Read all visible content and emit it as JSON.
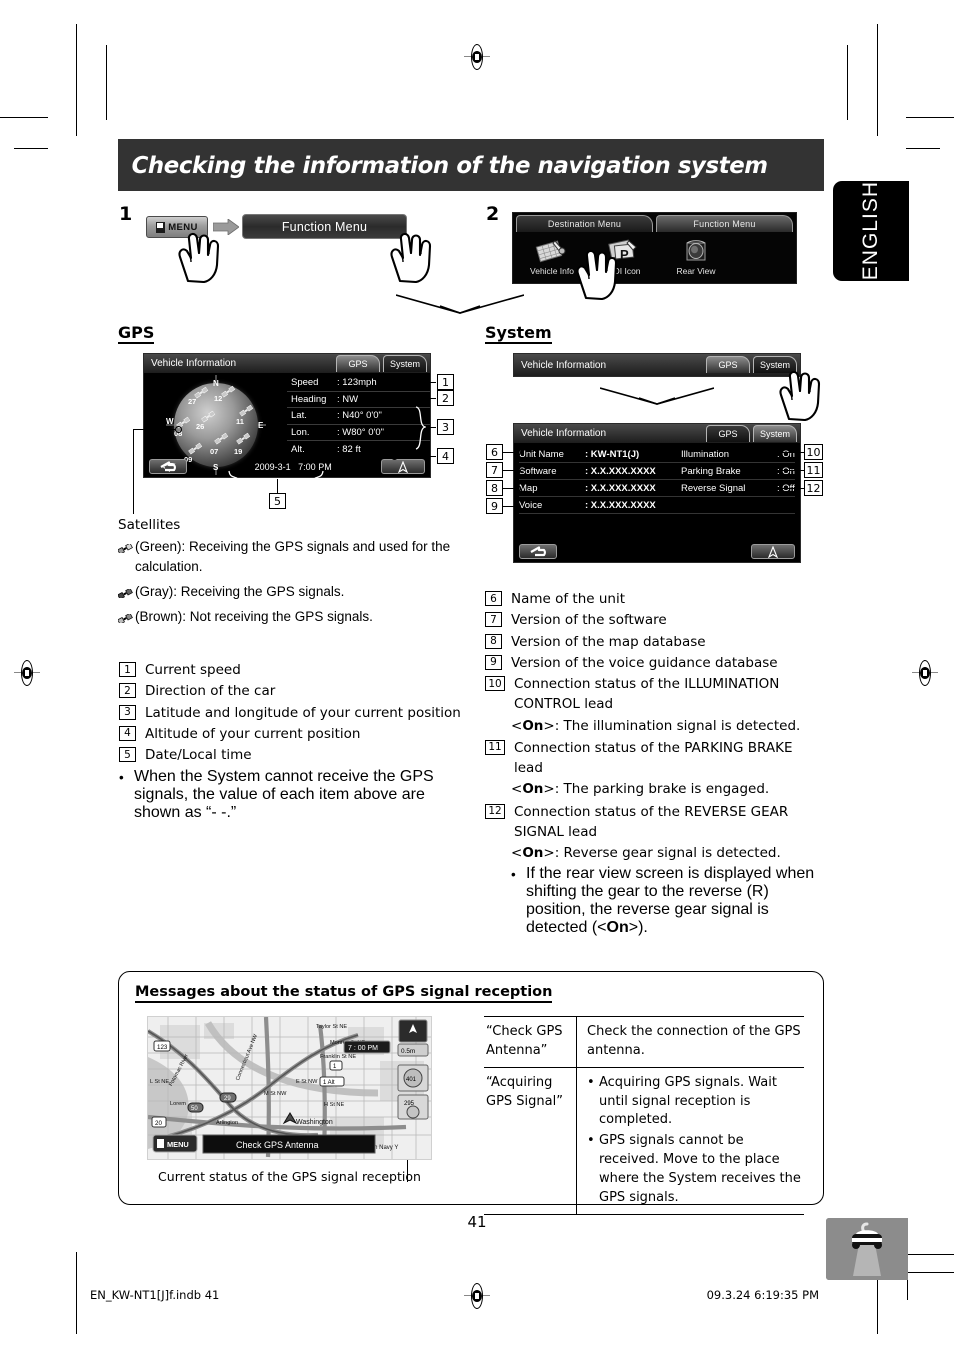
{
  "header": {
    "title": "Checking the information of the navigation system"
  },
  "language_tab": {
    "label": "ENGLISH"
  },
  "steps": {
    "one": {
      "number": "1",
      "menu_key_label": "MENU",
      "function_menu_button": "Function Menu"
    },
    "two": {
      "number": "2",
      "tabs": [
        {
          "label": "Destination Menu",
          "active": false
        },
        {
          "label": "Function Menu",
          "active": true
        }
      ],
      "icons": [
        {
          "label": "Vehicle Info",
          "icon": "vehicle-info-icon"
        },
        {
          "label": "POI Icon",
          "icon": "poi-icon"
        },
        {
          "label": "Rear View",
          "icon": "rear-view-icon"
        }
      ]
    }
  },
  "gps_section": {
    "heading": "GPS",
    "screen": {
      "title": "Vehicle Information",
      "tabs": [
        {
          "label": "GPS",
          "active": true
        },
        {
          "label": "System",
          "active": false
        }
      ],
      "compass": {
        "north": "N",
        "south": "S",
        "east": "E",
        "west": "W",
        "satellites": [
          "27",
          "12",
          "11",
          "26",
          "08",
          "07",
          "19",
          "09"
        ]
      },
      "rows": [
        {
          "key": "Speed",
          "value": ": 123mph"
        },
        {
          "key": "Heading",
          "value": ": NW"
        },
        {
          "key": "Lat.",
          "value": ": N40°  0'0\""
        },
        {
          "key": "Lon.",
          "value": ": W80°  0'0\""
        },
        {
          "key": "Alt.",
          "value": ": 82 ft"
        }
      ],
      "date": "2009-3-1",
      "time": "7:00 PM",
      "back_icon": "back-arrow-icon",
      "nav_icon": "navigation-arrow-icon"
    },
    "callouts": [
      "1",
      "2",
      "3",
      "4",
      "5"
    ],
    "satellites_label": "Satellites",
    "satellite_legend": [
      {
        "icon": "satellite-icon-green",
        "text": "(Green): Receiving the GPS signals and used for the calculation."
      },
      {
        "icon": "satellite-icon-gray",
        "text": "(Gray): Receiving the GPS signals."
      },
      {
        "icon": "satellite-icon-brown",
        "text": "(Brown): Not receiving the GPS signals."
      }
    ],
    "items": [
      {
        "n": "1",
        "text": "Current speed"
      },
      {
        "n": "2",
        "text": "Direction of the car"
      },
      {
        "n": "3",
        "text": "Latitude and longitude of your current position"
      },
      {
        "n": "4",
        "text": "Altitude of your current position"
      },
      {
        "n": "5",
        "text": "Date/Local time"
      }
    ],
    "note": "When the System cannot receive the GPS signals, the value of each item above are shown as “- -.”"
  },
  "system_section": {
    "heading": "System",
    "top_screen": {
      "title": "Vehicle Information",
      "tabs": [
        {
          "label": "GPS",
          "active": true
        },
        {
          "label": "System",
          "active": false
        }
      ]
    },
    "screen": {
      "title": "Vehicle Information",
      "tabs": [
        {
          "label": "GPS",
          "active": false
        },
        {
          "label": "System",
          "active": true
        }
      ],
      "rows": [
        {
          "key": "Unit Name",
          "value": ": KW-NT1(J)",
          "key2": "Illumination",
          "value2": ": On"
        },
        {
          "key": "Software",
          "value": ": X.X.XXX.XXXX",
          "key2": "Parking Brake",
          "value2": ": On"
        },
        {
          "key": "Map",
          "value": ": X.X.XXX.XXXX",
          "key2": "Reverse Signal",
          "value2": ": Off"
        },
        {
          "key": "Voice",
          "value": ": X.X.XXX.XXXX",
          "key2": "",
          "value2": ""
        }
      ],
      "back_icon": "back-arrow-icon",
      "nav_icon": "navigation-arrow-icon"
    },
    "callouts_left": [
      "6",
      "7",
      "8",
      "9"
    ],
    "callouts_right": [
      "10",
      "11",
      "12"
    ],
    "items": [
      {
        "n": "6",
        "text": "Name of the unit",
        "sub": ""
      },
      {
        "n": "7",
        "text": "Version of the software",
        "sub": ""
      },
      {
        "n": "8",
        "text": "Version of the map database",
        "sub": ""
      },
      {
        "n": "9",
        "text": "Version of the voice guidance database",
        "sub": ""
      },
      {
        "n": "10",
        "text": "Connection status of the ILLUMINATION CONTROL lead",
        "sub_prefix": "<",
        "sub_bold": "On",
        "sub_suffix": ">: The illumination signal is detected."
      },
      {
        "n": "11",
        "text": "Connection status of the PARKING BRAKE lead",
        "sub_prefix": "<",
        "sub_bold": "On",
        "sub_suffix": ">: The parking brake is engaged."
      },
      {
        "n": "12",
        "text": "Connection status of the REVERSE GEAR SIGNAL lead",
        "sub_prefix": "<",
        "sub_bold": "On",
        "sub_suffix": ">: Reverse gear signal is detected."
      }
    ],
    "final_bullet_1": "If the rear view screen is displayed when shifting the gear to the reverse (R) position, the reverse gear signal is detected (<",
    "final_bullet_bold": "On",
    "final_bullet_2": ">)."
  },
  "messages_panel": {
    "title": "Messages about the status of GPS signal reception",
    "map_caption": "Current status of the GPS signal reception",
    "map_overlay": {
      "menu_label": "MENU",
      "status_text": "Check GPS Antenna",
      "clock": "7:00 PM",
      "scale": "0.5m",
      "labels": [
        "Taylor St NE",
        "Monroe St NE",
        "Franklin St NE",
        "Washington",
        "Arlington",
        "Washington Navy Y",
        "123",
        "20",
        "29",
        "50",
        "1",
        "295",
        "I St NW",
        "H St NE",
        "E St NW"
      ]
    },
    "rows": [
      {
        "message": "“Check GPS Antenna”",
        "bullets": [
          "Check the connection of the GPS antenna."
        ],
        "bulleted": false
      },
      {
        "message": "“Acquiring GPS Signal”",
        "bullets": [
          "Acquiring GPS signals. Wait until signal reception is completed.",
          "GPS signals cannot be received. Move to the place where the System receives the GPS signals."
        ],
        "bulleted": true
      }
    ]
  },
  "footer": {
    "page_number": "41",
    "file_name": "EN_KW-NT1[J]f.indb   41",
    "timestamp": "09.3.24   6:19:35 PM",
    "rear_view_icon": "car-rear-view-icon"
  }
}
